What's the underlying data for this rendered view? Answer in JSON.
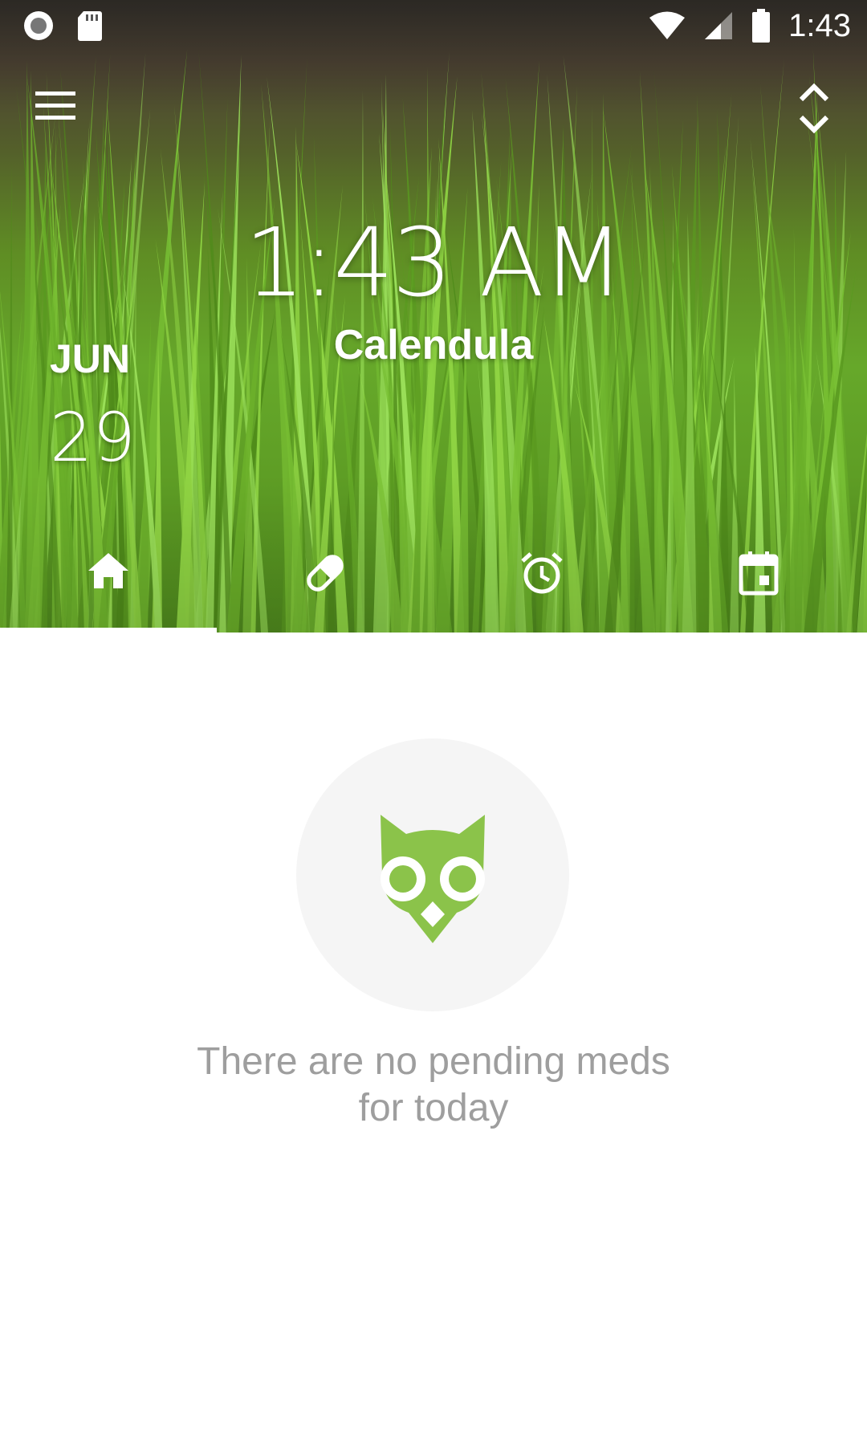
{
  "status_bar": {
    "time": "1:43",
    "left_icons": [
      "record-icon",
      "sd-card-icon"
    ],
    "right_icons": [
      "wifi-icon",
      "cell-signal-icon",
      "battery-icon"
    ]
  },
  "toolbar": {
    "menu_icon": "hamburger-menu-icon",
    "expand_icon": "unfold-more-icon"
  },
  "header": {
    "clock": "1:43 AM",
    "app_name": "Calendula",
    "month": "JUN",
    "day": "29"
  },
  "tabs": [
    {
      "icon": "home-icon",
      "selected": true
    },
    {
      "icon": "pill-icon",
      "selected": false
    },
    {
      "icon": "alarm-icon",
      "selected": false
    },
    {
      "icon": "calendar-icon",
      "selected": false
    }
  ],
  "empty_state": {
    "icon": "owl-icon",
    "message_line1": "There are no pending meds",
    "message_line2": "for today"
  },
  "colors": {
    "owl": "#8bc34a",
    "empty_text": "#9e9e9e",
    "circle_bg": "#f5f5f5"
  }
}
